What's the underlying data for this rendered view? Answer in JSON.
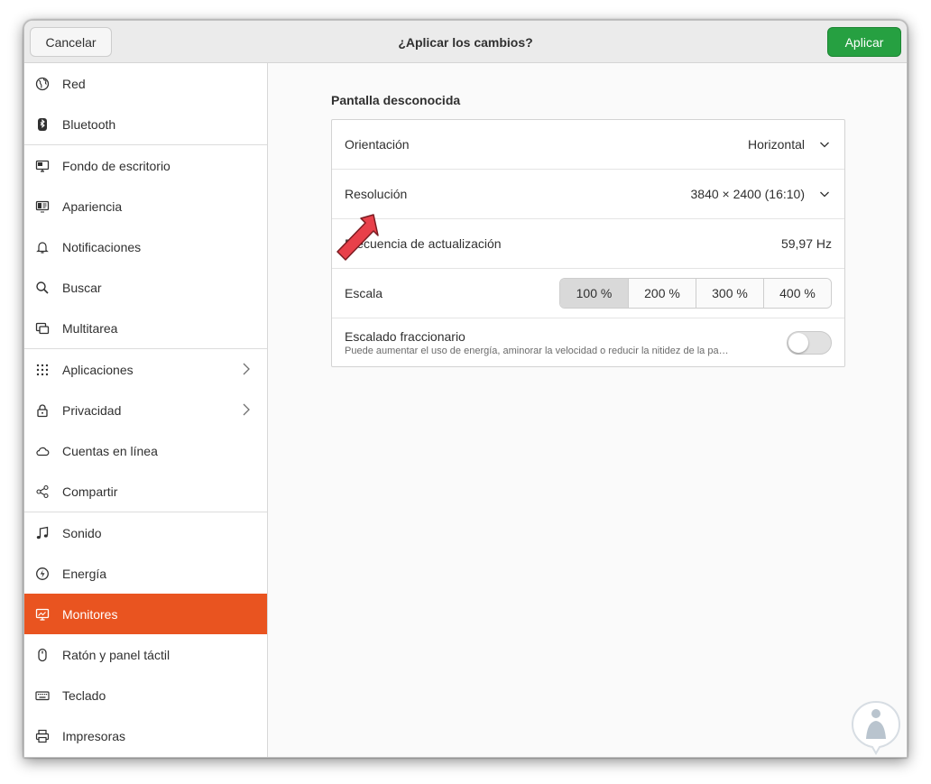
{
  "header": {
    "cancel_label": "Cancelar",
    "title": "¿Aplicar los cambios?",
    "apply_label": "Aplicar"
  },
  "sidebar": {
    "items": [
      {
        "label": "Red",
        "icon": "globe-icon"
      },
      {
        "label": "Bluetooth",
        "icon": "bluetooth-icon"
      },
      {
        "label": "Fondo de escritorio",
        "icon": "desktop-wallpaper-icon"
      },
      {
        "label": "Apariencia",
        "icon": "appearance-icon"
      },
      {
        "label": "Notificaciones",
        "icon": "bell-icon"
      },
      {
        "label": "Buscar",
        "icon": "search-icon"
      },
      {
        "label": "Multitarea",
        "icon": "multitasking-icon"
      },
      {
        "label": "Aplicaciones",
        "icon": "apps-grid-icon"
      },
      {
        "label": "Privacidad",
        "icon": "lock-icon"
      },
      {
        "label": "Cuentas en línea",
        "icon": "cloud-icon"
      },
      {
        "label": "Compartir",
        "icon": "share-icon"
      },
      {
        "label": "Sonido",
        "icon": "music-note-icon"
      },
      {
        "label": "Energía",
        "icon": "power-icon"
      },
      {
        "label": "Monitores",
        "icon": "monitor-icon"
      },
      {
        "label": "Ratón y panel táctil",
        "icon": "mouse-icon"
      },
      {
        "label": "Teclado",
        "icon": "keyboard-icon"
      },
      {
        "label": "Impresoras",
        "icon": "printer-icon"
      }
    ],
    "active": "Monitores"
  },
  "display": {
    "section_title": "Pantalla desconocida",
    "orientation_label": "Orientación",
    "orientation_value": "Horizontal",
    "resolution_label": "Resolución",
    "resolution_value": "3840 × 2400 (16:10)",
    "refresh_label": "Frecuencia de actualización",
    "refresh_value": "59,97 Hz",
    "scale_label": "Escala",
    "scale_options": [
      "100 %",
      "200 %",
      "300 %",
      "400 %"
    ],
    "scale_selected": "100 %",
    "fractional_label": "Escalado fraccionario",
    "fractional_desc": "Puede aumentar el uso de energía, aminorar la velocidad o reducir la nitidez de la pa…",
    "fractional_enabled": false
  },
  "colors": {
    "accent": "#e95420",
    "apply_button": "#26a041",
    "annotation_arrow": "#e8404a"
  }
}
